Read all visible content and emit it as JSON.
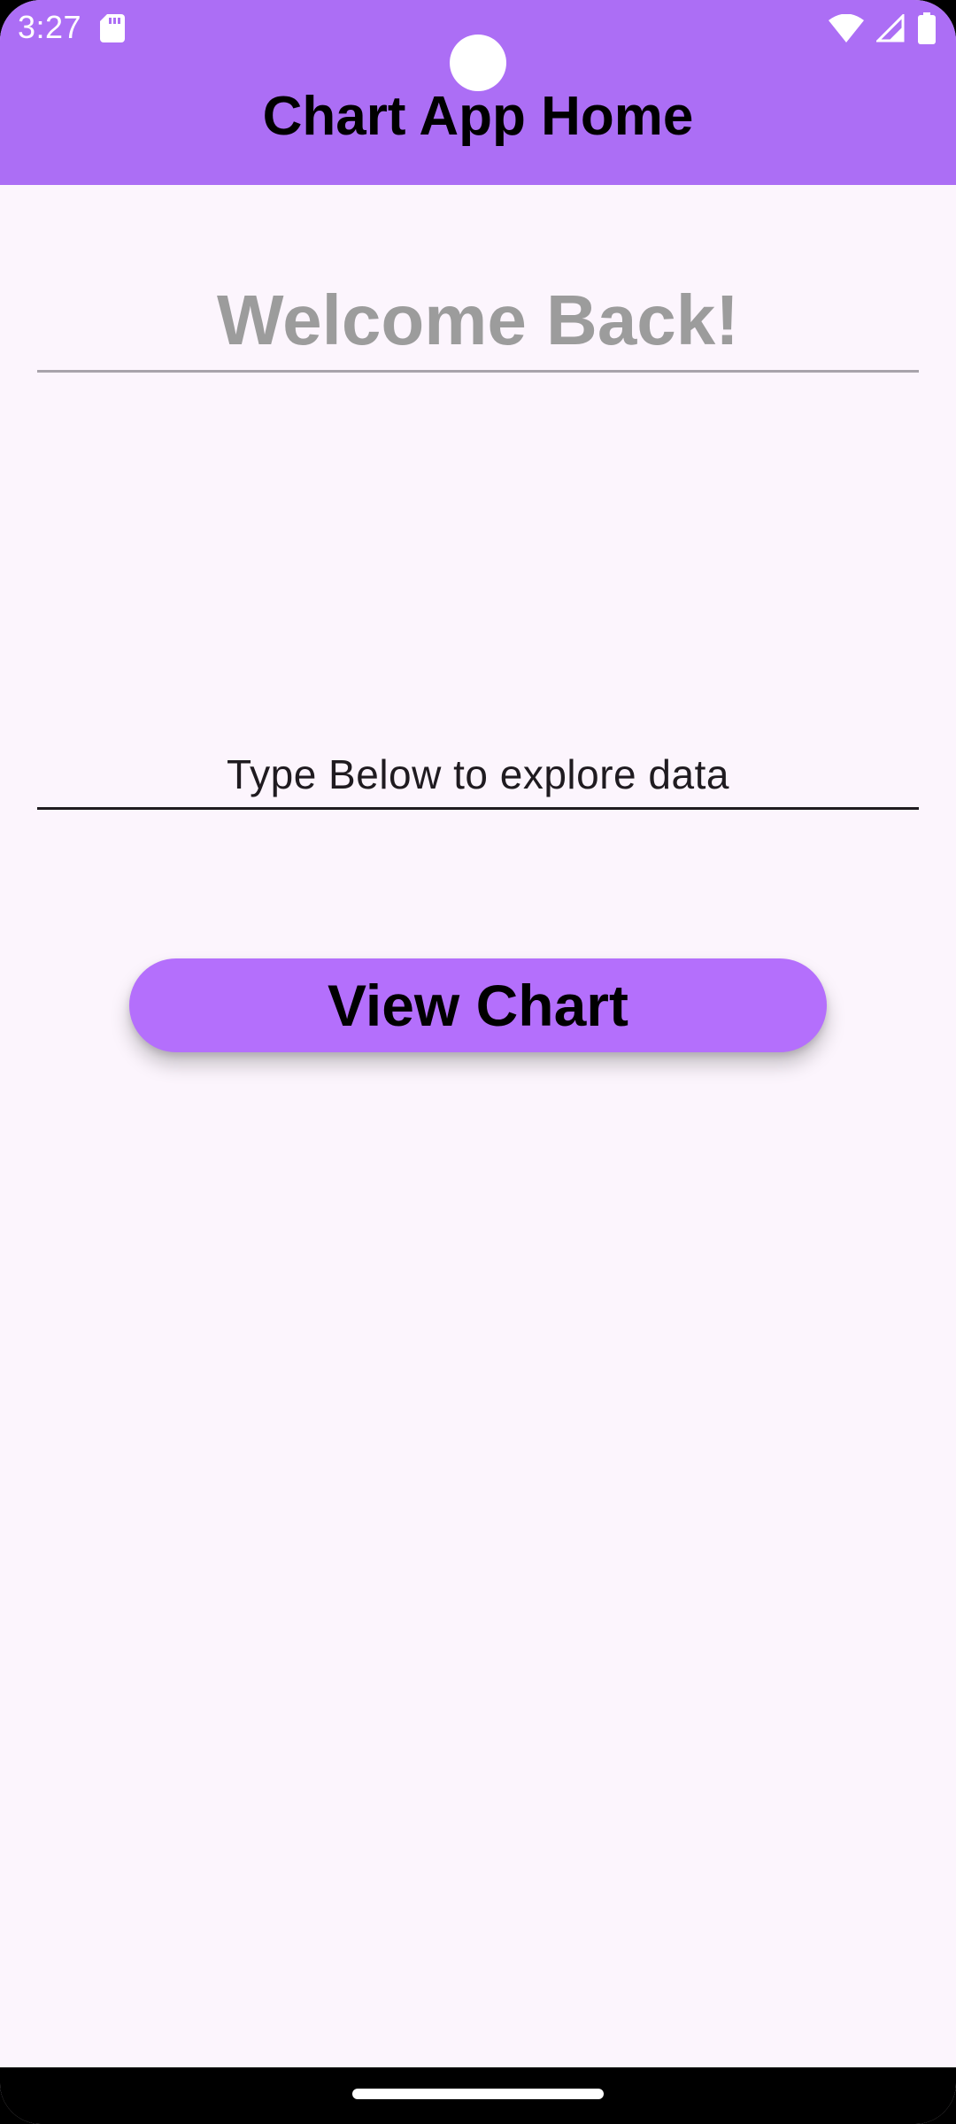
{
  "status_bar": {
    "time": "3:27",
    "icons": [
      "sd-card-icon",
      "wifi-icon",
      "cell-signal-icon",
      "battery-icon"
    ]
  },
  "app_bar": {
    "title": "Chart App Home",
    "color": "#ac6ef5"
  },
  "main": {
    "welcome_field": {
      "value": "Welcome Back!"
    },
    "explore_field": {
      "value": "Type Below to explore data"
    },
    "view_chart_button": {
      "label": "View Chart",
      "color": "#b46ffc"
    }
  },
  "colors": {
    "background": "#fcf5fd",
    "text_primary": "#000000",
    "text_muted": "#9c9c9c"
  }
}
